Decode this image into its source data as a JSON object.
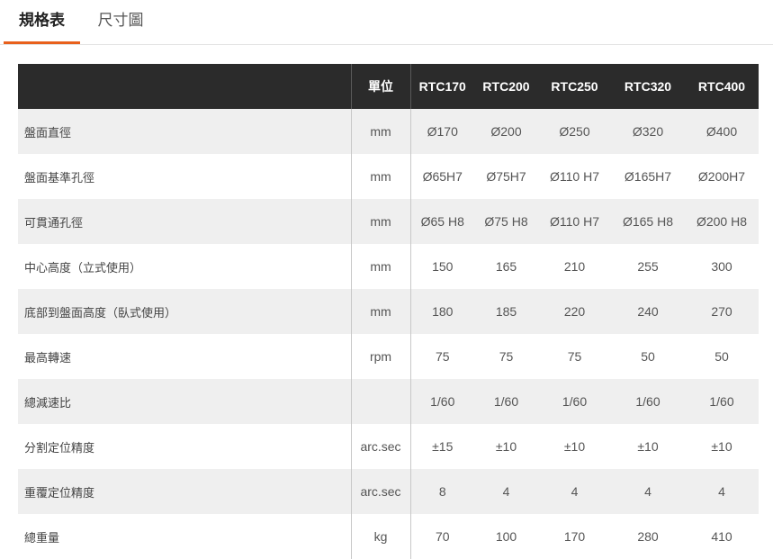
{
  "tabs": [
    {
      "label": "規格表",
      "active": true
    },
    {
      "label": "尺寸圖",
      "active": false
    }
  ],
  "colors": {
    "accent": "#e8601c",
    "header_bg": "#2b2b2b",
    "row_stripe": "#efefef"
  },
  "table": {
    "headers": [
      "",
      "單位",
      "RTC170",
      "RTC200",
      "RTC250",
      "RTC320",
      "RTC400"
    ],
    "rows": [
      {
        "label": "盤面直徑",
        "unit": "mm",
        "values": [
          "Ø170",
          "Ø200",
          "Ø250",
          "Ø320",
          "Ø400"
        ]
      },
      {
        "label": "盤面基準孔徑",
        "unit": "mm",
        "values": [
          "Ø65H7",
          "Ø75H7",
          "Ø110 H7",
          "Ø165H7",
          "Ø200H7"
        ]
      },
      {
        "label": "可貫通孔徑",
        "unit": "mm",
        "values": [
          "Ø65 H8",
          "Ø75 H8",
          "Ø110 H7",
          "Ø165 H8",
          "Ø200 H8"
        ]
      },
      {
        "label": "中心高度（立式使用）",
        "unit": "mm",
        "values": [
          "150",
          "165",
          "210",
          "255",
          "300"
        ]
      },
      {
        "label": "底部到盤面高度（臥式使用）",
        "unit": "mm",
        "values": [
          "180",
          "185",
          "220",
          "240",
          "270"
        ]
      },
      {
        "label": "最高轉速",
        "unit": "rpm",
        "values": [
          "75",
          "75",
          "75",
          "50",
          "50"
        ]
      },
      {
        "label": "總減速比",
        "unit": "",
        "values": [
          "1/60",
          "1/60",
          "1/60",
          "1/60",
          "1/60"
        ]
      },
      {
        "label": "分割定位精度",
        "unit": "arc.sec",
        "values": [
          "±15",
          "±10",
          "±10",
          "±10",
          "±10"
        ]
      },
      {
        "label": "重覆定位精度",
        "unit": "arc.sec",
        "values": [
          "8",
          "4",
          "4",
          "4",
          "4"
        ]
      },
      {
        "label": "總重量",
        "unit": "kg",
        "values": [
          "70",
          "100",
          "170",
          "280",
          "410"
        ]
      }
    ]
  }
}
